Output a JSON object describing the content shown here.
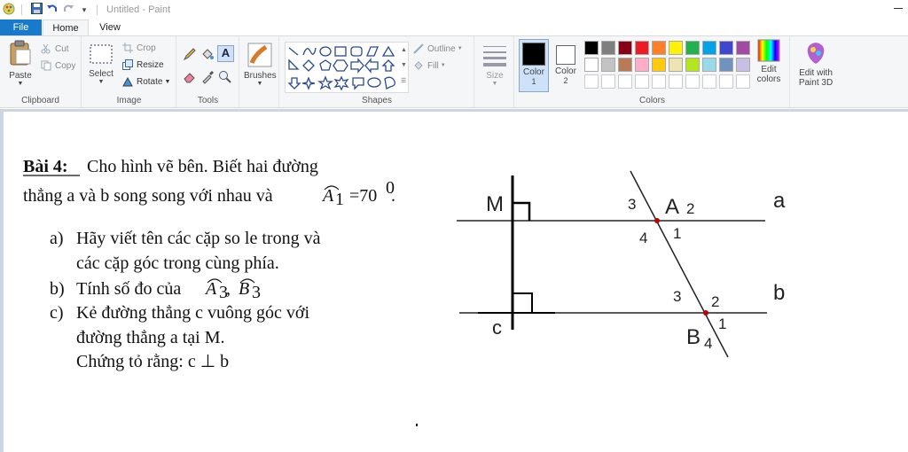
{
  "titlebar": {
    "title": "Untitled - Paint",
    "quick_access": [
      "paint-app-icon",
      "save-icon",
      "undo-icon",
      "redo-icon",
      "customize-icon"
    ]
  },
  "tabs": {
    "file": "File",
    "home": "Home",
    "view": "View"
  },
  "ribbon": {
    "clipboard": {
      "label": "Clipboard",
      "paste": "Paste",
      "cut": "Cut",
      "copy": "Copy"
    },
    "image": {
      "label": "Image",
      "select": "Select",
      "crop": "Crop",
      "resize": "Resize",
      "rotate": "Rotate"
    },
    "tools": {
      "label": "Tools"
    },
    "brushes": {
      "label": "Brushes"
    },
    "shapes": {
      "label": "Shapes",
      "outline": "Outline",
      "fill": "Fill"
    },
    "size": {
      "label": "Size"
    },
    "colors": {
      "label": "Colors",
      "color1": "Color",
      "color1_num": "1",
      "color2": "Color",
      "color2_num": "2",
      "edit_colors": "Edit",
      "edit_colors2": "colors",
      "paint3d": "Edit with",
      "paint3d2": "Paint 3D",
      "palette_row1": [
        "#000000",
        "#7f7f7f",
        "#880015",
        "#ed1c24",
        "#ff7f27",
        "#fff200",
        "#22b14c",
        "#00a2e8",
        "#3f48cc",
        "#a349a4"
      ],
      "palette_row2": [
        "#ffffff",
        "#c3c3c3",
        "#b97a57",
        "#ffaec9",
        "#ffc90e",
        "#efe4b0",
        "#b5e61d",
        "#99d9ea",
        "#7092be",
        "#c8bfe7"
      ]
    }
  },
  "document": {
    "problem_title": "Bài 4:",
    "problem_line1": "Cho hình vẽ bên.  Biết hai đường",
    "problem_line2a": "thẳng a và b song song với nhau và",
    "angle_a1_letter": "A",
    "angle_a1_sub": "1",
    "angle_a1_value": "=70",
    "degree": "0",
    "period": ".",
    "item_a_label": "a)",
    "item_a_line1": "Hãy viết tên các cặp so le trong và",
    "item_a_line2": "các cặp góc trong cùng phía.",
    "item_b_label": "b)",
    "item_b_text": "Tính số đo của",
    "angle_a3_letter": "A",
    "angle_a3_sub": "3",
    "comma": ",",
    "angle_b3_letter": "B",
    "angle_b3_sub": "3",
    "item_c_label": "c)",
    "item_c_line1": "Kẻ đường thẳng c vuông góc với",
    "item_c_line2": "đường thẳng a tại M.",
    "item_c_line3": "Chứng tỏ rằng: c ⊥ b"
  },
  "figure": {
    "label_M": "M",
    "label_A": "A",
    "label_B": "B",
    "label_a": "a",
    "label_b": "b",
    "label_c": "c",
    "angle_A_2": "2",
    "angle_A_3": "3",
    "angle_A_4": "4",
    "angle_A_1": "1",
    "angle_B_3": "3",
    "angle_B_2": "2",
    "angle_B_1": "1",
    "angle_B_4": "4"
  }
}
